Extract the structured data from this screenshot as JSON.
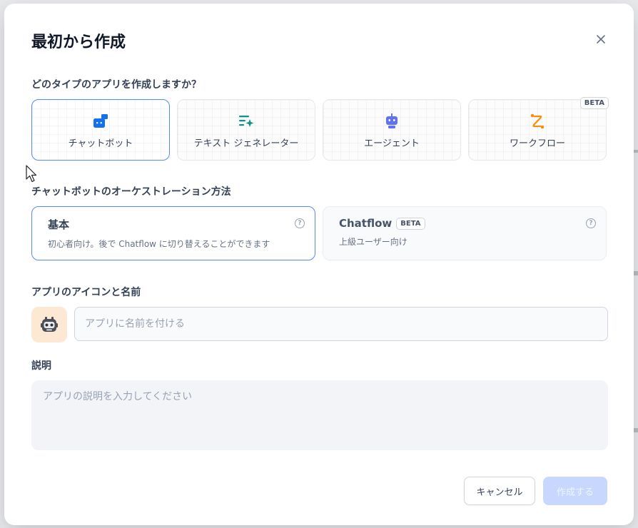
{
  "dialog": {
    "title": "最初から作成",
    "close_icon": "close-icon"
  },
  "app_type": {
    "question": "どのタイプのアプリを作成しますか？",
    "options": [
      {
        "label": "チャットボット",
        "icon": "chatbot-icon",
        "selected": true
      },
      {
        "label": "テキスト ジェネレーター",
        "icon": "text-generator-icon",
        "selected": false
      },
      {
        "label": "エージェント",
        "icon": "agent-robot-icon",
        "selected": false
      },
      {
        "label": "ワークフロー",
        "icon": "workflow-icon",
        "selected": false,
        "badge": "BETA"
      }
    ]
  },
  "orchestration": {
    "label": "チャットボットのオーケストレーション方法",
    "options": [
      {
        "title": "基本",
        "description": "初心者向け。後で Chatflow に切り替えることができます",
        "selected": true
      },
      {
        "title": "Chatflow",
        "badge": "BETA",
        "description": "上級ユーザー向け",
        "selected": false
      }
    ],
    "help_glyph": "?"
  },
  "icon_name": {
    "label": "アプリのアイコンと名前",
    "icon": "robot-avatar-icon",
    "name_placeholder": "アプリに名前を付ける",
    "name_value": ""
  },
  "description": {
    "label": "説明",
    "placeholder": "アプリの説明を入力してください"
  },
  "actions": {
    "cancel_label": "キャンセル",
    "create_label": "作成する"
  },
  "colors": {
    "accent": "#528bff",
    "chatbot_icon": "#1570ef",
    "text_generator_icon": "#0e9384",
    "agent_icon": "#6172f3",
    "workflow_icon": "#f79009",
    "create_disabled": "#c7d7fe"
  }
}
